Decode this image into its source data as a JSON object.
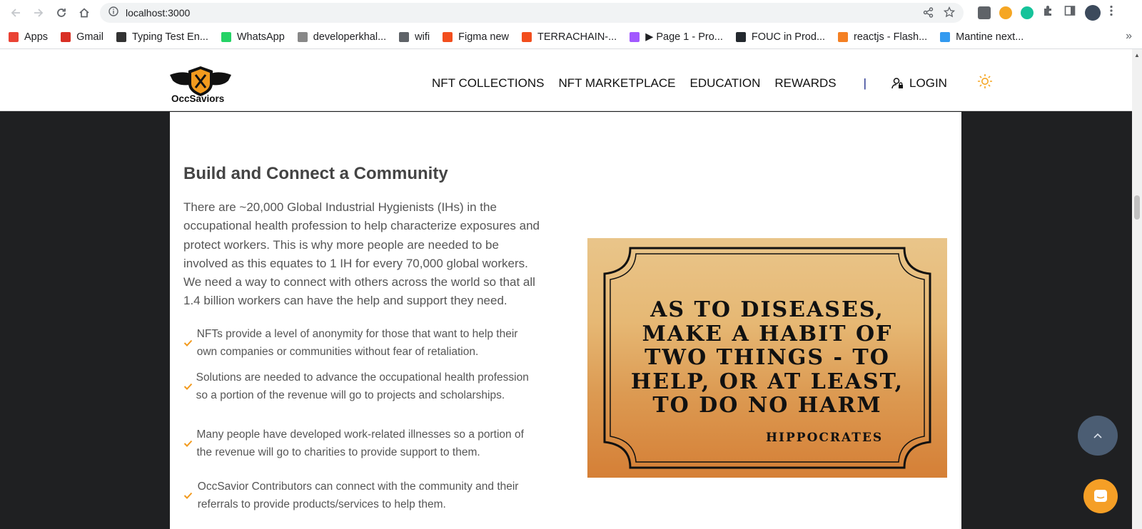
{
  "browser": {
    "url": "localhost:3000",
    "bookmarks": [
      {
        "label": "Apps",
        "color": "#ea4335"
      },
      {
        "label": "Gmail",
        "color": "#d93025"
      },
      {
        "label": "Typing Test En...",
        "color": "#333333"
      },
      {
        "label": "WhatsApp",
        "color": "#25d366"
      },
      {
        "label": "developerkhal...",
        "color": "#888888"
      },
      {
        "label": "wifi",
        "color": "#5f6368"
      },
      {
        "label": "Figma new",
        "color": "#f24e1e"
      },
      {
        "label": "TERRACHAIN-...",
        "color": "#f24e1e"
      },
      {
        "label": "▶ Page 1 - Pro...",
        "color": "#a259ff"
      },
      {
        "label": "FOUC in Prod...",
        "color": "#24292f"
      },
      {
        "label": "reactjs - Flash...",
        "color": "#f48024"
      },
      {
        "label": "Mantine next...",
        "color": "#339af0"
      }
    ],
    "more": "»"
  },
  "site": {
    "logo_text": "OccSaviors",
    "nav": [
      "NFT COLLECTIONS",
      "NFT MARKETPLACE",
      "EDUCATION",
      "REWARDS"
    ],
    "separator": "|",
    "login_label": "LOGIN"
  },
  "section": {
    "title": "Build and Connect a Community",
    "intro": "There are ~20,000 Global Industrial Hygienists (IHs) in the occupational health profession to help characterize exposures and protect workers. This is why more people are needed to be involved as this equates to 1 IH for every 70,000 global workers. We need a way to connect with others across the world so that all 1.4 billion workers can have the help and support they need.",
    "bullets": [
      "NFTs provide a level of anonymity for those that want to help their own companies or communities without fear of retaliation.",
      "Solutions are needed to advance the occupational health profession so a portion of the revenue will go to projects and scholarships.",
      "Many people have developed work-related illnesses so a portion of the revenue will go to charities to provide support to them.",
      "OccSavior Contributors can connect with the community and their referrals to provide products/services to help them."
    ],
    "quote": "AS TO DISEASES, MAKE A HABIT OF TWO THINGS - TO HELP, OR AT LEAST, TO DO NO HARM",
    "quote_author": "HIPPOCRATES"
  },
  "colors": {
    "accent": "#f29a1e",
    "nav_separator": "#1d2a8a",
    "to_top": "#4b5d73",
    "chat": "#f59f26"
  }
}
